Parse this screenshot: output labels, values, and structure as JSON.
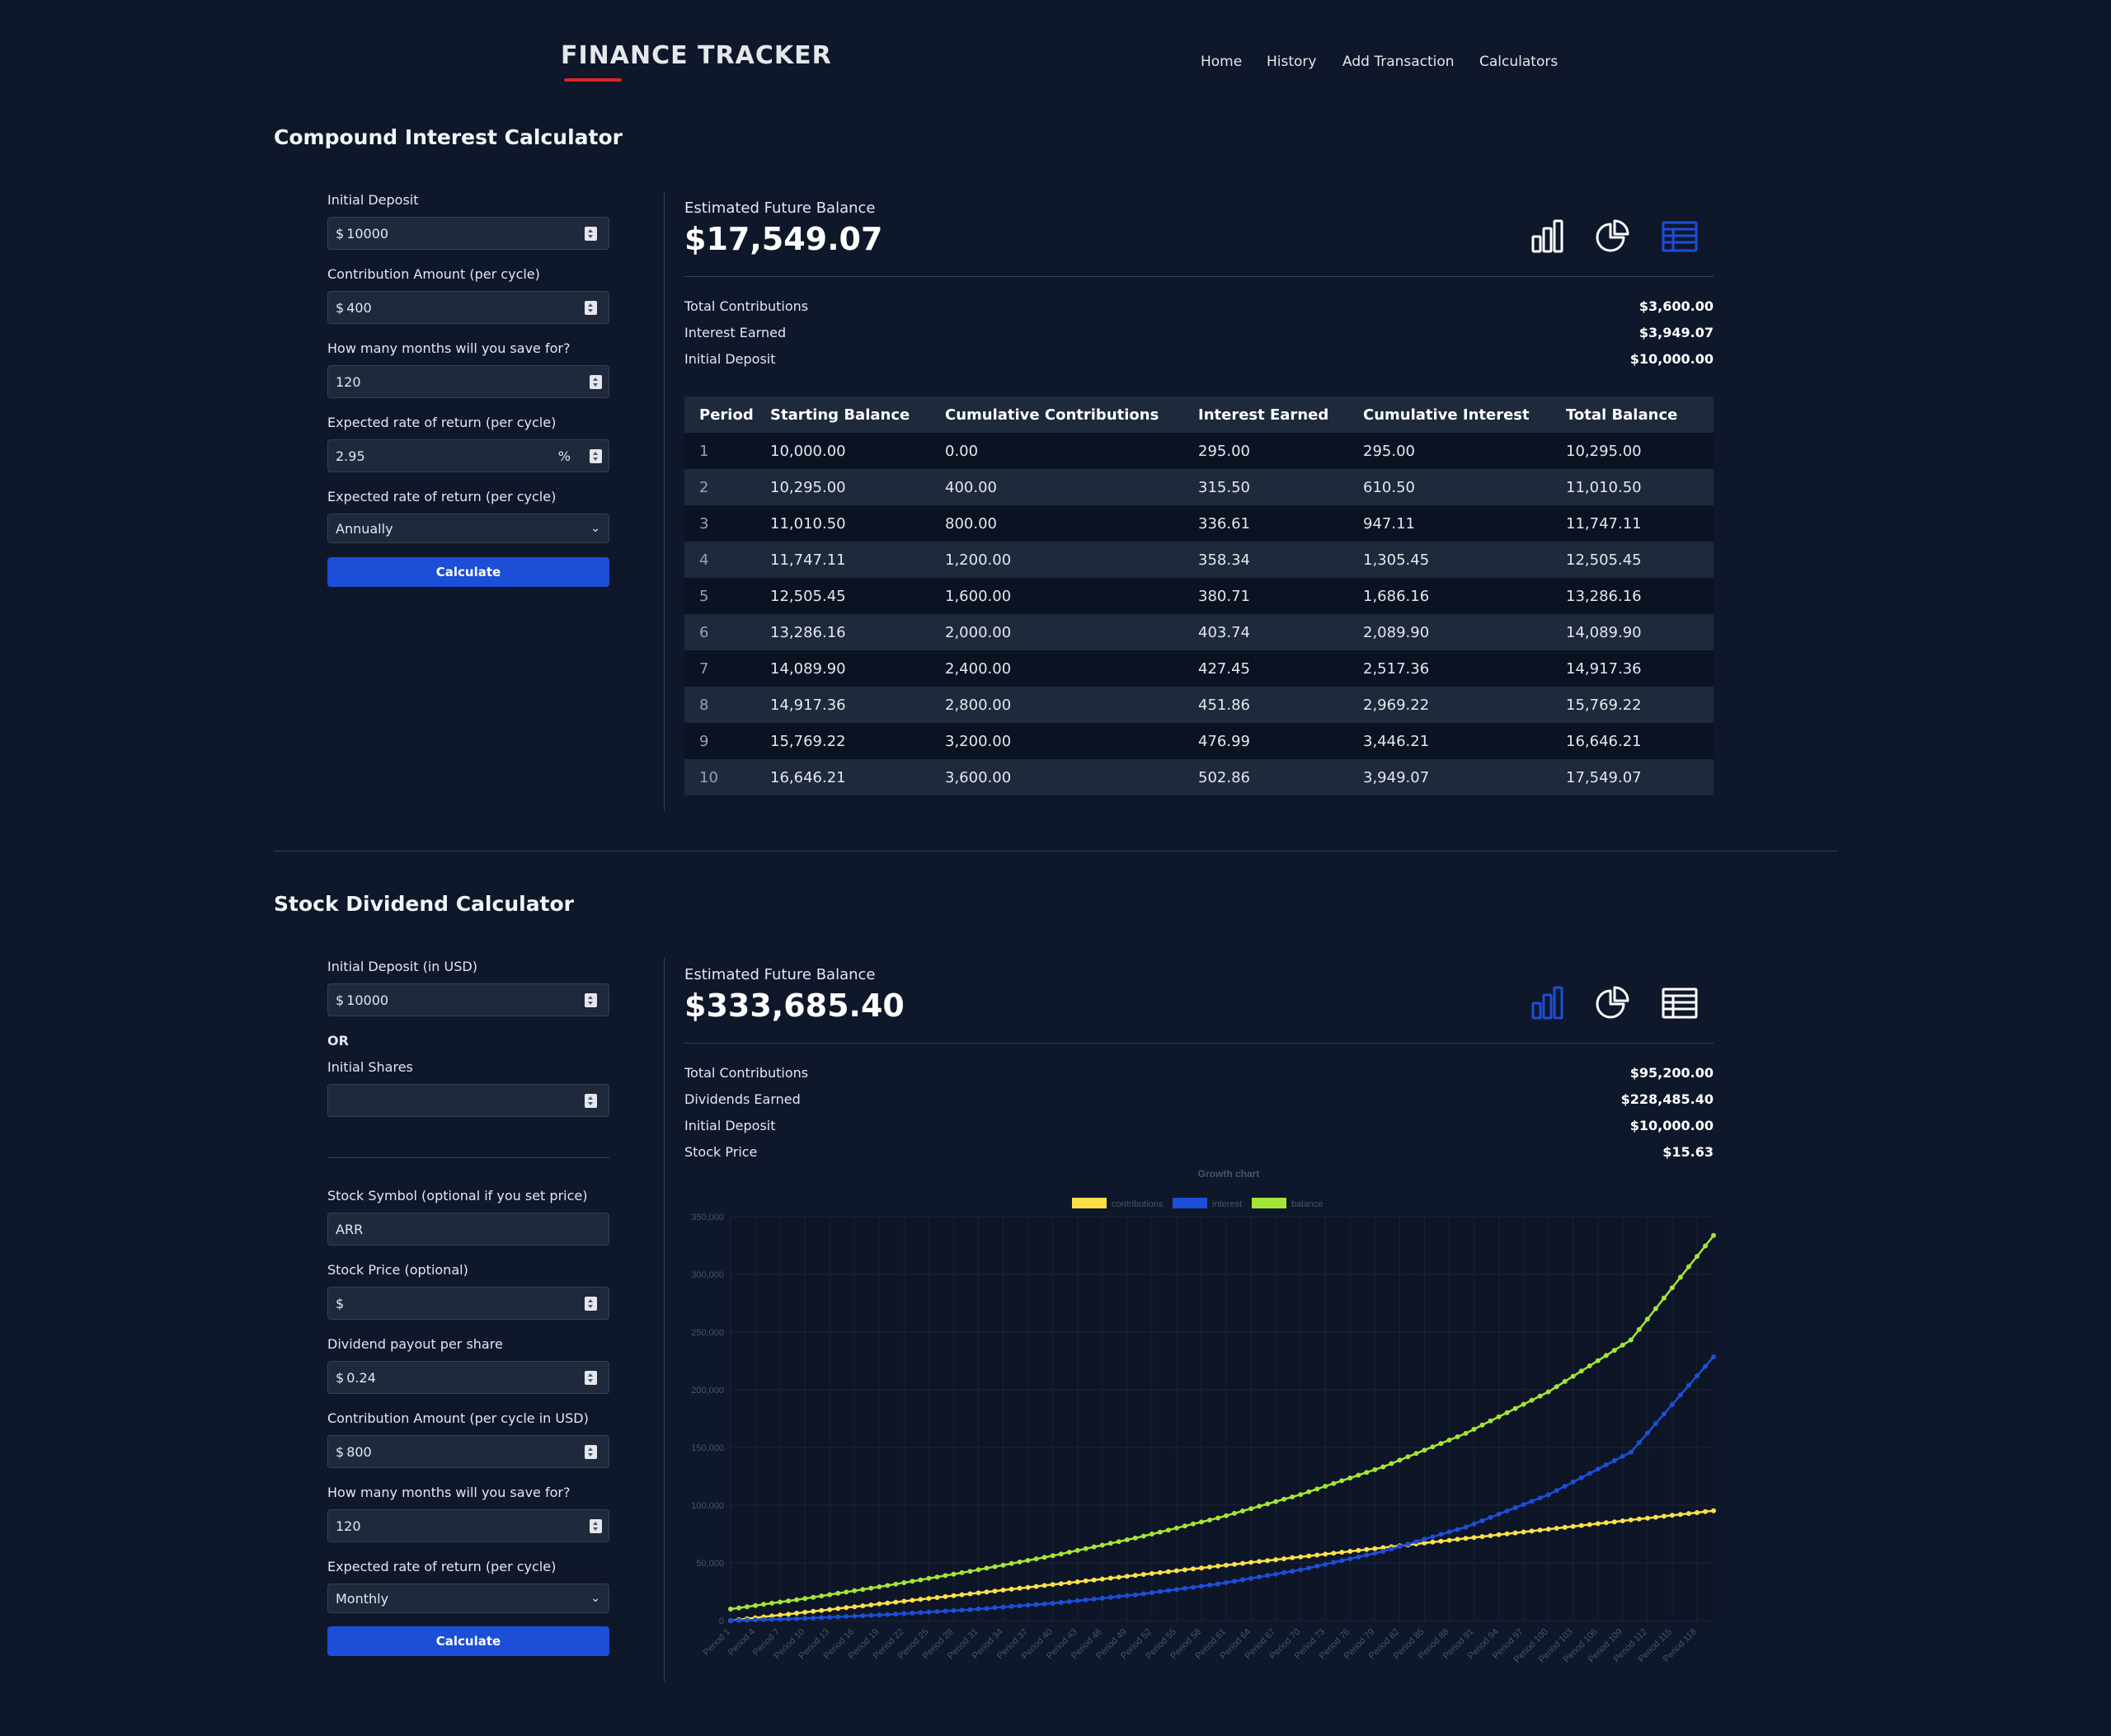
{
  "header": {
    "brand": "FINANCE TRACKER",
    "nav": [
      "Home",
      "History",
      "Add Transaction",
      "Calculators"
    ]
  },
  "compound": {
    "title": "Compound Interest Calculator",
    "form": {
      "initial_deposit_label": "Initial Deposit",
      "initial_deposit_prefix": "$",
      "initial_deposit_value": "10000",
      "contribution_label": "Contribution Amount (per cycle)",
      "contribution_prefix": "$",
      "contribution_value": "400",
      "months_label": "How many months will you save for?",
      "months_value": "120",
      "rate_label": "Expected rate of return (per cycle)",
      "rate_value": "2.95",
      "rate_suffix": "%",
      "frequency_label": "Expected rate of return (per cycle)",
      "frequency_value": "Annually",
      "calculate_label": "Calculate"
    },
    "result": {
      "label": "Estimated Future Balance",
      "value": "$17,549.07",
      "summary": [
        {
          "label": "Total Contributions",
          "value": "$3,600.00"
        },
        {
          "label": "Interest Earned",
          "value": "$3,949.07"
        },
        {
          "label": "Initial Deposit",
          "value": "$10,000.00"
        }
      ],
      "view_icons": [
        "bar-chart-icon",
        "pie-chart-icon",
        "table-icon"
      ],
      "active_view": "table-icon",
      "active_color": "#1d4ed8"
    },
    "table": {
      "columns": [
        "Period",
        "Starting Balance",
        "Cumulative Contributions",
        "Interest Earned",
        "Cumulative Interest",
        "Total Balance"
      ],
      "rows": [
        [
          "1",
          "10,000.00",
          "0.00",
          "295.00",
          "295.00",
          "10,295.00"
        ],
        [
          "2",
          "10,295.00",
          "400.00",
          "315.50",
          "610.50",
          "11,010.50"
        ],
        [
          "3",
          "11,010.50",
          "800.00",
          "336.61",
          "947.11",
          "11,747.11"
        ],
        [
          "4",
          "11,747.11",
          "1,200.00",
          "358.34",
          "1,305.45",
          "12,505.45"
        ],
        [
          "5",
          "12,505.45",
          "1,600.00",
          "380.71",
          "1,686.16",
          "13,286.16"
        ],
        [
          "6",
          "13,286.16",
          "2,000.00",
          "403.74",
          "2,089.90",
          "14,089.90"
        ],
        [
          "7",
          "14,089.90",
          "2,400.00",
          "427.45",
          "2,517.36",
          "14,917.36"
        ],
        [
          "8",
          "14,917.36",
          "2,800.00",
          "451.86",
          "2,969.22",
          "15,769.22"
        ],
        [
          "9",
          "15,769.22",
          "3,200.00",
          "476.99",
          "3,446.21",
          "16,646.21"
        ],
        [
          "10",
          "16,646.21",
          "3,600.00",
          "502.86",
          "3,949.07",
          "17,549.07"
        ]
      ]
    }
  },
  "dividend": {
    "title": "Stock Dividend Calculator",
    "form": {
      "initial_deposit_label": "Initial Deposit (in USD)",
      "initial_deposit_prefix": "$",
      "initial_deposit_value": "10000",
      "or_label": "OR",
      "initial_shares_label": "Initial Shares",
      "initial_shares_value": "",
      "symbol_label": "Stock Symbol (optional if you set price)",
      "symbol_value": "ARR",
      "price_label": "Stock Price (optional)",
      "price_prefix": "$",
      "price_value": "",
      "payout_label": "Dividend payout per share",
      "payout_prefix": "$",
      "payout_value": "0.24",
      "contribution_label": "Contribution Amount (per cycle in USD)",
      "contribution_prefix": "$",
      "contribution_value": "800",
      "months_label": "How many months will you save for?",
      "months_value": "120",
      "frequency_label": "Expected rate of return (per cycle)",
      "frequency_value": "Monthly",
      "calculate_label": "Calculate"
    },
    "result": {
      "label": "Estimated Future Balance",
      "value": "$333,685.40",
      "summary": [
        {
          "label": "Total Contributions",
          "value": "$95,200.00"
        },
        {
          "label": "Dividends Earned",
          "value": "$228,485.40"
        },
        {
          "label": "Initial Deposit",
          "value": "$10,000.00"
        },
        {
          "label": "Stock Price",
          "value": "$15.63"
        }
      ],
      "view_icons": [
        "bar-chart-icon",
        "pie-chart-icon",
        "table-icon"
      ],
      "active_view": "bar-chart-icon",
      "active_color": "#1d4ed8"
    }
  },
  "chart_data": {
    "type": "line",
    "title": "Growth chart",
    "xlabel": "",
    "ylabel": "",
    "ylim": [
      0,
      350000
    ],
    "yticks": [
      "0",
      "50,000",
      "100,000",
      "150,000",
      "200,000",
      "250,000",
      "300,000",
      "350,000"
    ],
    "x_tick_labels": [
      "Period 1",
      "Period 4",
      "Period 7",
      "Period 10",
      "Period 13",
      "Period 16",
      "Period 19",
      "Period 22",
      "Period 25",
      "Period 28",
      "Period 31",
      "Period 34",
      "Period 37",
      "Period 40",
      "Period 43",
      "Period 46",
      "Period 49",
      "Period 52",
      "Period 55",
      "Period 58",
      "Period 61",
      "Period 64",
      "Period 67",
      "Period 70",
      "Period 73",
      "Period 76",
      "Period 79",
      "Period 82",
      "Period 85",
      "Period 88",
      "Period 91",
      "Period 94",
      "Period 97",
      "Period 100",
      "Period 103",
      "Period 106",
      "Period 109",
      "Period 112",
      "Period 115",
      "Period 118"
    ],
    "legend_position": "top-center",
    "grid": true,
    "series": [
      {
        "name": "contributions",
        "color": "#fde047",
        "x": [
          1,
          10,
          20,
          30,
          40,
          50,
          60,
          70,
          80,
          90,
          100,
          110,
          120
        ],
        "values": [
          0,
          7200,
          15200,
          23200,
          31200,
          39200,
          47200,
          55200,
          63200,
          71200,
          79200,
          87200,
          95200
        ]
      },
      {
        "name": "interest",
        "color": "#1d4ed8",
        "x": [
          1,
          10,
          20,
          30,
          40,
          50,
          60,
          70,
          80,
          90,
          100,
          110,
          120
        ],
        "values": [
          0,
          1900,
          5200,
          9500,
          15000,
          22300,
          31700,
          44000,
          60000,
          81000,
          109000,
          146000,
          228485.4
        ]
      },
      {
        "name": "balance",
        "color": "#a3e635",
        "x": [
          1,
          10,
          20,
          30,
          40,
          50,
          60,
          70,
          80,
          90,
          100,
          110,
          120
        ],
        "values": [
          10000,
          19100,
          30400,
          42700,
          56200,
          71500,
          88900,
          109200,
          133200,
          162200,
          198200,
          243200,
          333685.4
        ]
      }
    ]
  }
}
